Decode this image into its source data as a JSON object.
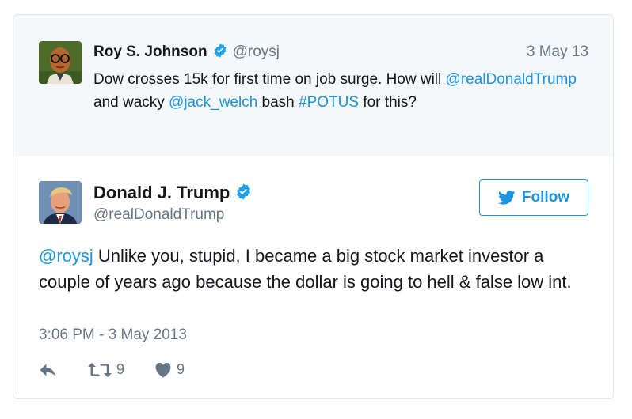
{
  "parent_tweet": {
    "name": "Roy S. Johnson",
    "handle": "@roysj",
    "date": "3 May 13",
    "text_segments": [
      {
        "text": "Dow crosses 15k for first time on job surge. How will ",
        "link": false
      },
      {
        "text": "@realDonaldTrump",
        "link": true
      },
      {
        "text": " and wacky ",
        "link": false
      },
      {
        "text": "@jack_welch",
        "link": true
      },
      {
        "text": " bash ",
        "link": false
      },
      {
        "text": "#POTUS",
        "link": true
      },
      {
        "text": " for this?",
        "link": false
      }
    ]
  },
  "main_tweet": {
    "name": "Donald J. Trump",
    "handle": "@realDonaldTrump",
    "follow_label": "Follow",
    "text_segments": [
      {
        "text": "@roysj",
        "link": true
      },
      {
        "text": " Unlike you, stupid, I became a big stock market investor a couple of years ago because the dollar is going to hell & false low int.",
        "link": false
      }
    ],
    "timestamp": "3:06 PM - 3 May 2013",
    "retweet_count": "9",
    "like_count": "9"
  },
  "colors": {
    "link": "#1b95e0",
    "secondary_text": "#657786",
    "parent_background": "#f5f8fa",
    "verified_badge": "#1da1f2"
  },
  "icons": {
    "verified": "verified-badge-icon",
    "reply": "reply-icon",
    "retweet": "retweet-icon",
    "like": "heart-icon",
    "bird": "twitter-bird-icon"
  }
}
